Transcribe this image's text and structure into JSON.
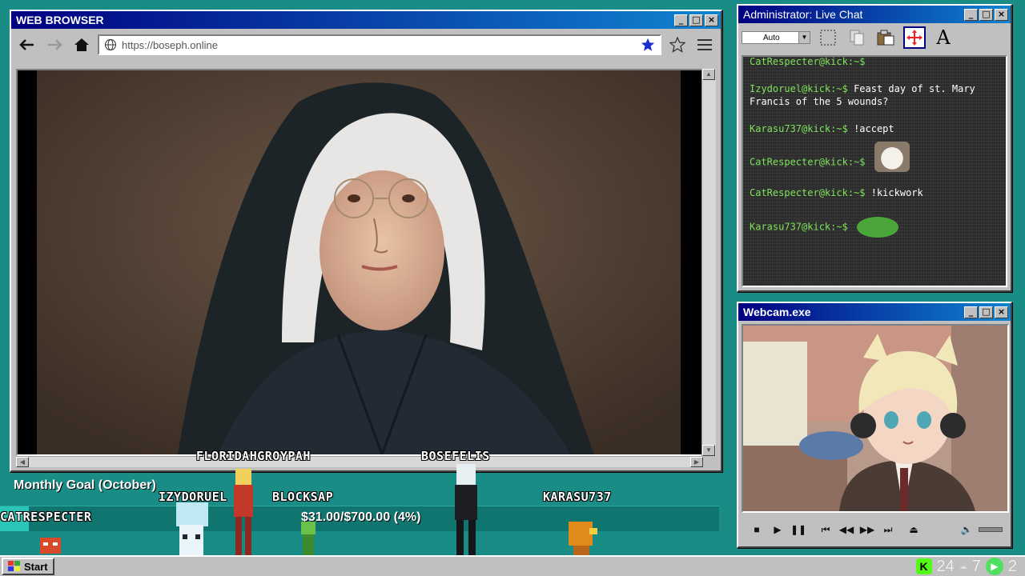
{
  "browser": {
    "title": "WEB BROWSER",
    "url": "https://boseph.online"
  },
  "chat": {
    "title": "Administrator: Live Chat",
    "zoom_select": "Auto",
    "messages": [
      {
        "user": "CatRespecter@kick:~$",
        "text": "",
        "emote": "cat-emote"
      },
      {
        "user": "Izydoruel@kick:~$",
        "text": "Feast day of st. Mary Francis of the 5 wounds?"
      },
      {
        "user": "Karasu737@kick:~$",
        "text": "!accept"
      },
      {
        "user": "CatRespecter@kick:~$",
        "text": "",
        "emote": "cat-emote"
      },
      {
        "user": "CatRespecter@kick:~$",
        "text": "!kickwork"
      },
      {
        "user": "Karasu737@kick:~$",
        "text": "",
        "emote": "frog-emote"
      }
    ]
  },
  "webcam": {
    "title": "Webcam.exe"
  },
  "overlay": {
    "goal_title": "Monthly Goal (October)",
    "goal_amount": "$31.00/$700.00 (4%)",
    "goal_progress": 0.04,
    "nicks": {
      "floridahgroypah": "FLORIDAHGROYPAH",
      "bosefelis": "BOSEFELIS",
      "izydoruel": "IZYDORUEL",
      "blocksap": "BLOCKSAP",
      "karasu737": "KARASU737",
      "catrespecter": "CATRESPECTER"
    }
  },
  "taskbar": {
    "start_label": "Start",
    "tray": {
      "count_a": "24",
      "count_b": "7",
      "count_c": "2"
    }
  },
  "colors": {
    "desktop": "#1a8c86",
    "titlebar": "#000080",
    "chat_user": "#7ee35a"
  }
}
